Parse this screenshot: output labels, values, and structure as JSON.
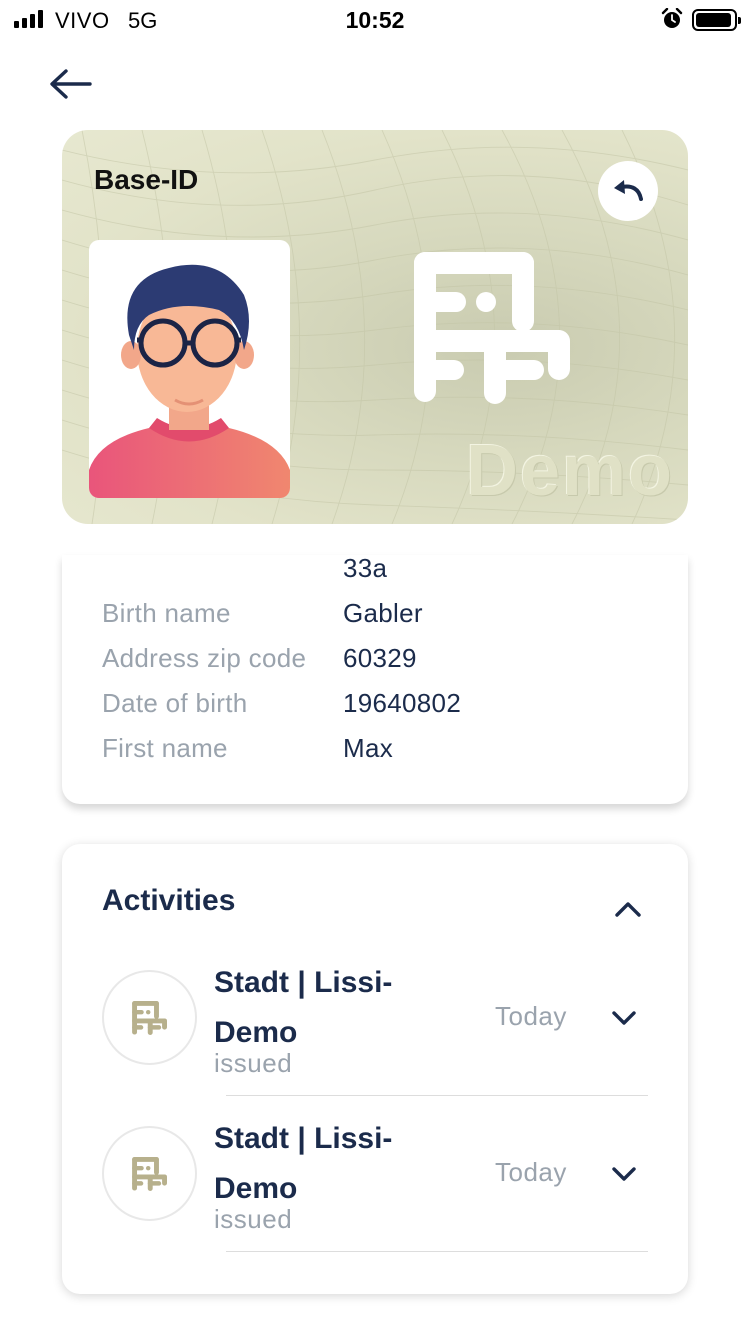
{
  "status_bar": {
    "carrier": "VIVO",
    "network": "5G",
    "time": "10:52",
    "icons": [
      "signal-icon",
      "alarm-icon",
      "battery-icon"
    ]
  },
  "nav": {
    "back_icon": "arrow-left-icon"
  },
  "credential_card": {
    "title": "Base-ID",
    "watermark": "Demo",
    "flip_icon": "undo-icon",
    "colors": {
      "card": "#e2e3c9",
      "accent": "#1b2b4b"
    }
  },
  "attributes": {
    "partial_value": "33a",
    "rows": [
      {
        "label": "Birth name",
        "value": "Gabler"
      },
      {
        "label": "Address zip code",
        "value": "60329"
      },
      {
        "label": "Date of birth",
        "value": "19640802"
      },
      {
        "label": "First name",
        "value": "Max"
      }
    ]
  },
  "activities": {
    "title": "Activities",
    "items": [
      {
        "issuer": "Stadt | Lissi-Demo",
        "status": "issued",
        "date": "Today"
      },
      {
        "issuer": "Stadt | Lissi-Demo",
        "status": "issued",
        "date": "Today"
      }
    ]
  }
}
